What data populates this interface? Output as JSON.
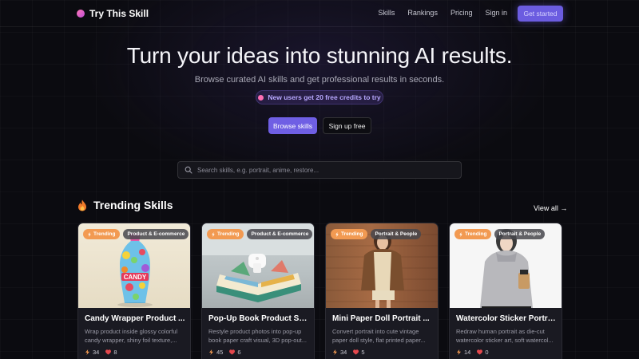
{
  "nav": {
    "logo": "Try This Skill",
    "links": [
      "Skills",
      "Rankings",
      "Pricing",
      "Sign in"
    ],
    "cta": "Get started"
  },
  "hero": {
    "title": "Turn your ideas into stunning AI results.",
    "subtitle": "Browse curated AI skills and get professional results in seconds.",
    "promo": "New users get 20 free credits to try",
    "browse_button": "Browse skills",
    "signup_button": "Sign up free"
  },
  "search": {
    "placeholder": "Search skills, e.g. portrait, anime, restore..."
  },
  "section": {
    "title": "Trending Skills",
    "view_all": "View all →"
  },
  "cards": [
    {
      "trend": "Trending",
      "category": "Product & E-commerce",
      "title": "Candy Wrapper Product ...",
      "desc_line1": "Wrap product inside glossy colorful",
      "desc_line2": "candy wrapper, shiny foil texture,...",
      "uses": "34",
      "likes": "8"
    },
    {
      "trend": "Trending",
      "category": "Product & E-commerce",
      "title": "Pop-Up Book Product Sty...",
      "desc_line1": "Restyle product photos into pop-up",
      "desc_line2": "book paper craft visual, 3D pop-out...",
      "uses": "45",
      "likes": "6"
    },
    {
      "trend": "Trending",
      "category": "Portrait & People",
      "title": "Mini Paper Doll Portrait ...",
      "desc_line1": "Convert portrait into cute vintage",
      "desc_line2": "paper doll style, flat printed paper...",
      "uses": "34",
      "likes": "5"
    },
    {
      "trend": "Trending",
      "category": "Portrait & People",
      "title": "Watercolor Sticker Portra...",
      "desc_line1": "Redraw human portrait as die-cut",
      "desc_line2": "watercolor sticker art, soft watercol...",
      "uses": "14",
      "likes": "0"
    }
  ],
  "colors": {
    "accent": "#6f5fe4",
    "trend_badge": "#f29a52",
    "like_heart": "#e5484d",
    "bolt": "#f29a52"
  }
}
